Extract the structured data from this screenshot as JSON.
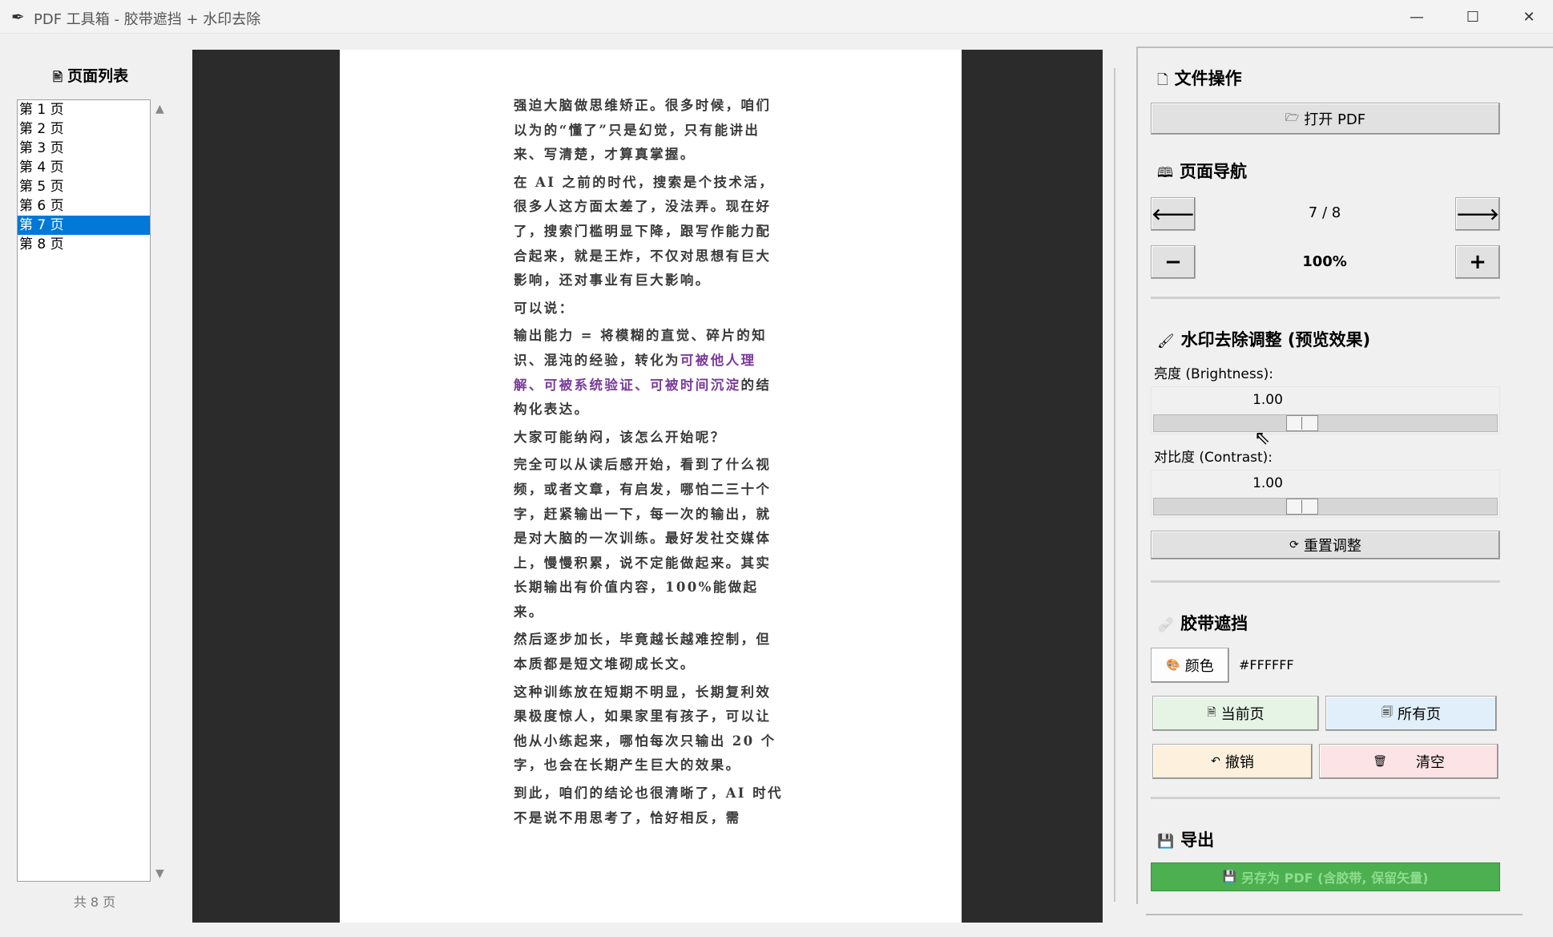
{
  "window": {
    "title": "PDF 工具箱 - 胶带遮挡 + 水印去除",
    "min": "—",
    "max": "☐",
    "close": "✕"
  },
  "left": {
    "title": "页面列表",
    "pages": [
      "第 1 页",
      "第 2 页",
      "第 3 页",
      "第 4 页",
      "第 5 页",
      "第 6 页",
      "第 7 页",
      "第 8 页"
    ],
    "selected_index": 6,
    "count": "共 8 页"
  },
  "preview": {
    "paragraphs": [
      "强迫大脑做思维矫正。很多时候，咱们以为的“懂了”只是幻觉，只有能讲出来、写清楚，才算真掌握。",
      "在 AI 之前的时代，搜索是个技术活，很多人这方面太差了，没法弄。现在好了，搜索门槛明显下降，跟写作能力配合起来，就是王炸，不仅对思想有巨大影响，还对事业有巨大影响。",
      "可以说："
    ],
    "highlight_para": {
      "before": "输出能力 = 将模糊的直觉、碎片的知识、混沌的经验，转化为",
      "highlight": "可被他人理解、可被系统验证、可被时间沉淀",
      "after": "的结构化表达。"
    },
    "paragraphs2": [
      "大家可能纳闷，该怎么开始呢？",
      "完全可以从读后感开始，看到了什么视频，或者文章，有启发，哪怕二三十个字，赶紧输出一下，每一次的输出，就是对大脑的一次训练。最好发社交媒体上，慢慢积累，说不定能做起来。其实长期输出有价值内容，100%能做起来。",
      "然后逐步加长，毕竟越长越难控制，但本质都是短文堆砌成长文。",
      "这种训练放在短期不明显，长期复利效果极度惊人，如果家里有孩子，可以让他从小练起来，哪怕每次只输出 20 个字，也会在长期产生巨大的效果。",
      "到此，咱们的结论也很清晰了，AI 时代不是说不用思考了，恰好相反，需"
    ]
  },
  "right": {
    "file_ops": {
      "title": "文件操作",
      "open_btn": "打开 PDF"
    },
    "nav": {
      "title": "页面导航",
      "prev": "🡐",
      "next": "🡒",
      "page_indicator": "7 / 8",
      "zoom_out": "−",
      "zoom_in": "+",
      "zoom": "100%"
    },
    "watermark": {
      "title": "水印去除调整 (预览效果)",
      "brightness_label": "亮度 (Brightness):",
      "brightness_value": "1.00",
      "brightness": 1.0,
      "contrast_label": "对比度 (Contrast):",
      "contrast_value": "1.00",
      "contrast": 1.0,
      "reset_btn": "重置调整"
    },
    "tape": {
      "title": "胶带遮挡",
      "color_btn": "颜色",
      "color_hex": "#FFFFFF",
      "current_page_btn": "当前页",
      "all_pages_btn": "所有页",
      "undo_btn": "撤销",
      "clear_btn": "清空"
    },
    "export": {
      "title": "导出",
      "save_btn": "另存为 PDF (含胶带, 保留矢量)"
    }
  },
  "colors": {
    "selection": "#0078d7",
    "highlight_text": "#7a3a9a",
    "current_page_btn_bg": "#e6f4e6",
    "all_pages_btn_bg": "#e1effa",
    "undo_btn_bg": "#fdf0dc",
    "clear_btn_bg": "#fce4e6",
    "export_btn_bg": "#4caf50"
  }
}
